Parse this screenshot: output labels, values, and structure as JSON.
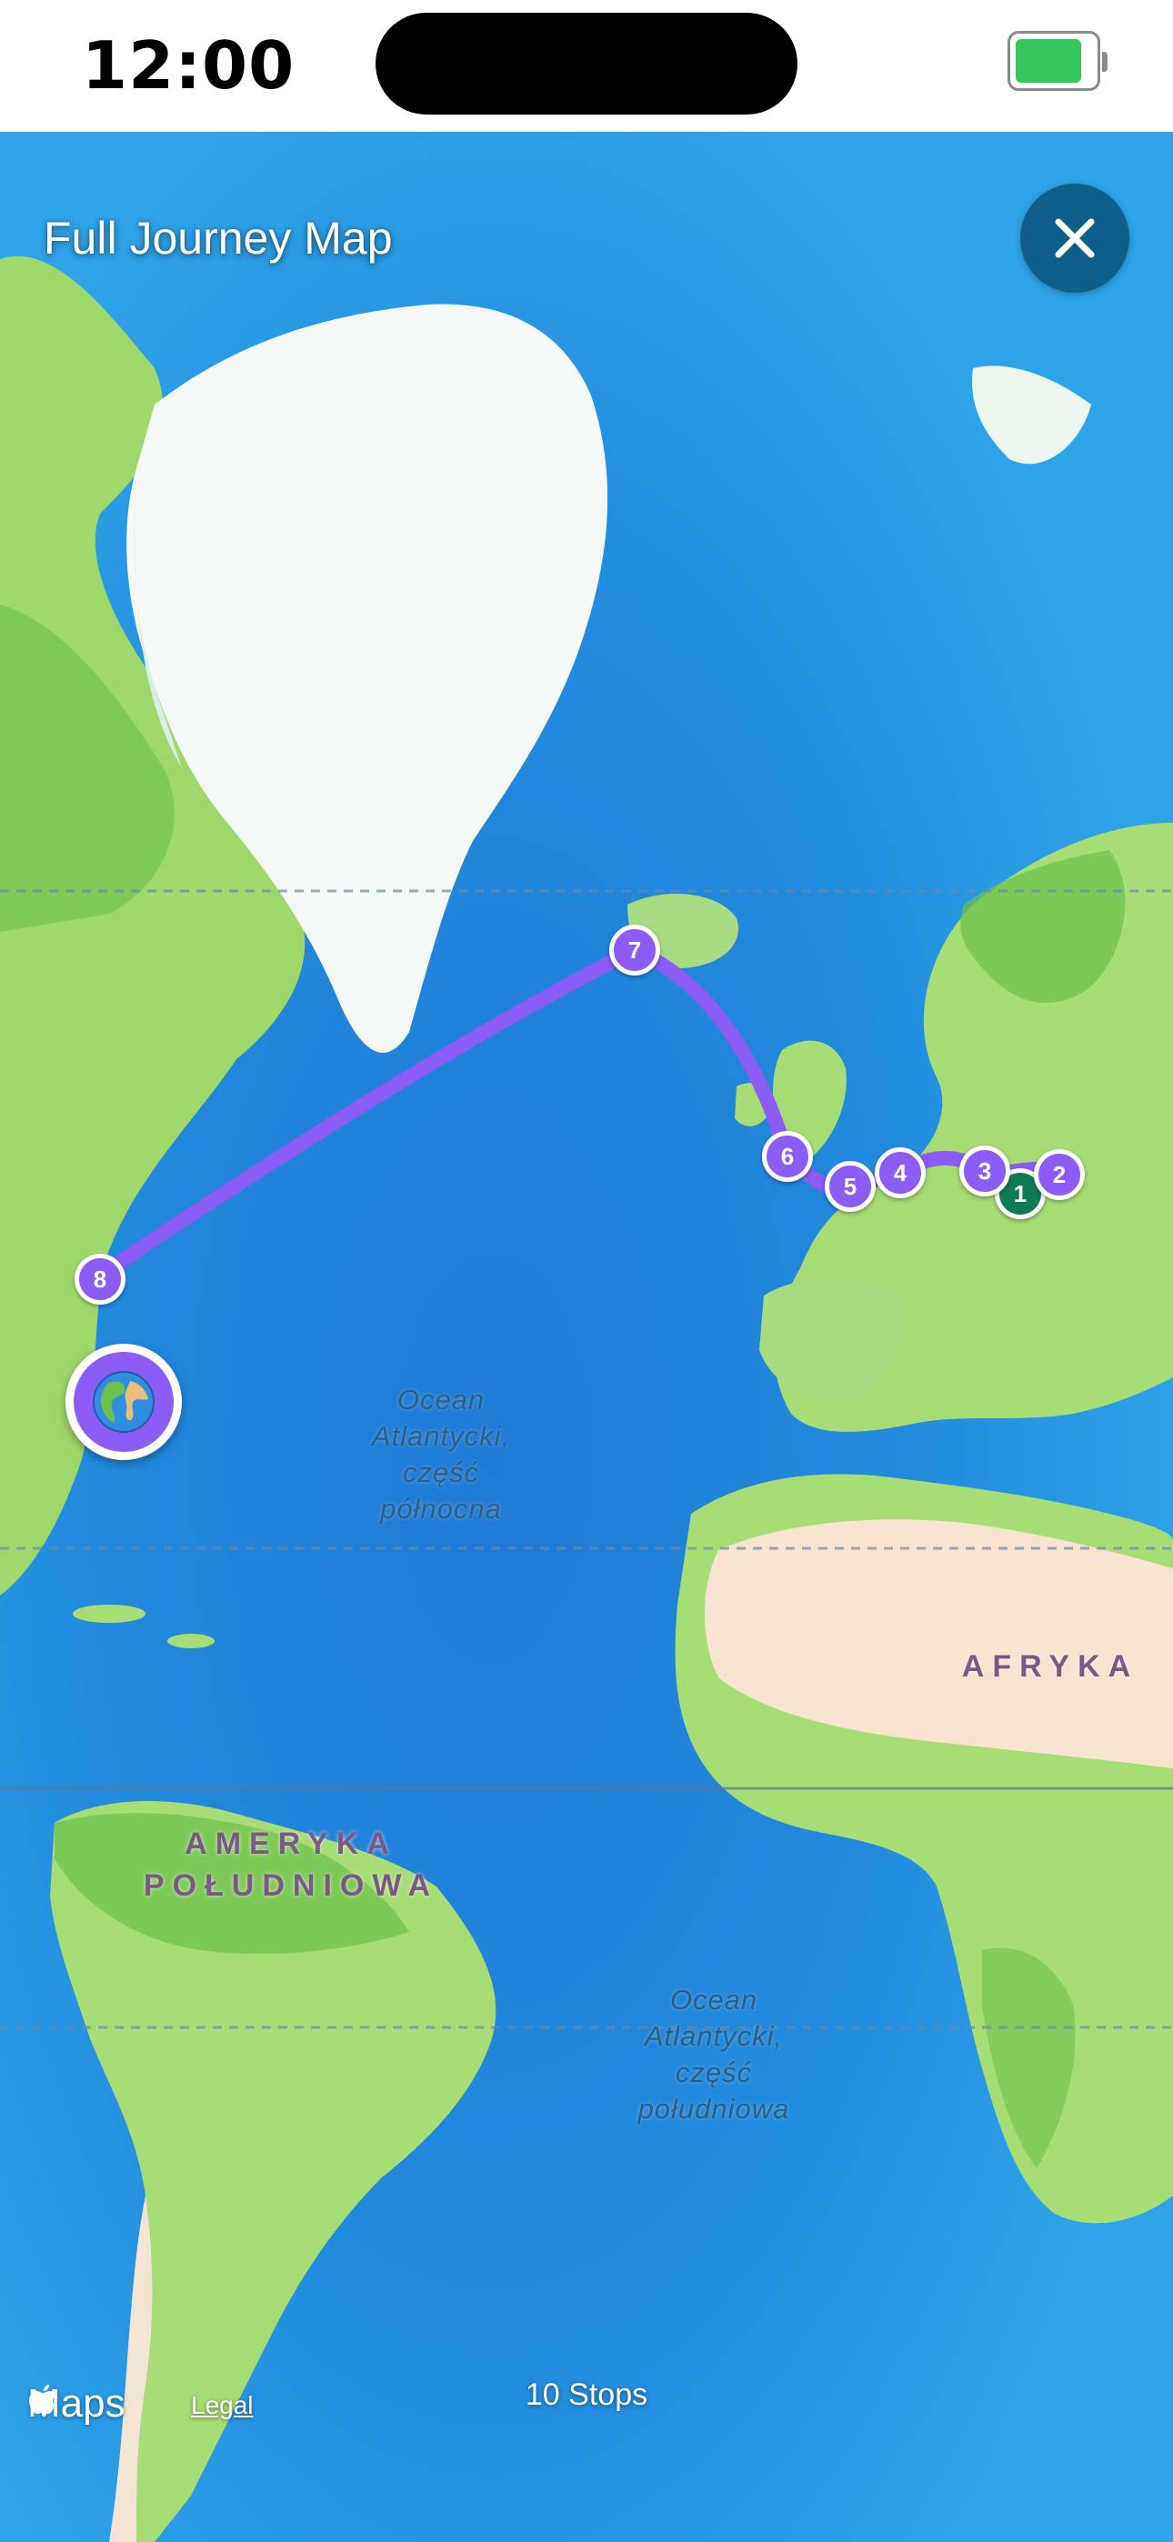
{
  "status_bar": {
    "time": "12:00",
    "battery_color": "#34c759"
  },
  "map": {
    "title": "Full Journey Map",
    "close_icon": "close-icon",
    "route_color": "#8b5cf6",
    "labels": {
      "ocean_north": "Ocean Atlantycki, część północna",
      "ocean_south": "Ocean Atlantycki, część południowa",
      "africa": "AFRYKA",
      "south_america": "AMERYKA POŁUDNIOWA"
    },
    "stops": [
      {
        "number": "1",
        "is_start": true
      },
      {
        "number": "2"
      },
      {
        "number": "3"
      },
      {
        "number": "4"
      },
      {
        "number": "5"
      },
      {
        "number": "6"
      },
      {
        "number": "7"
      },
      {
        "number": "8"
      }
    ],
    "current_location_icon": "globe-icon",
    "attribution": {
      "brand": "Maps",
      "legal": "Legal"
    },
    "stops_count": "10 Stops"
  }
}
